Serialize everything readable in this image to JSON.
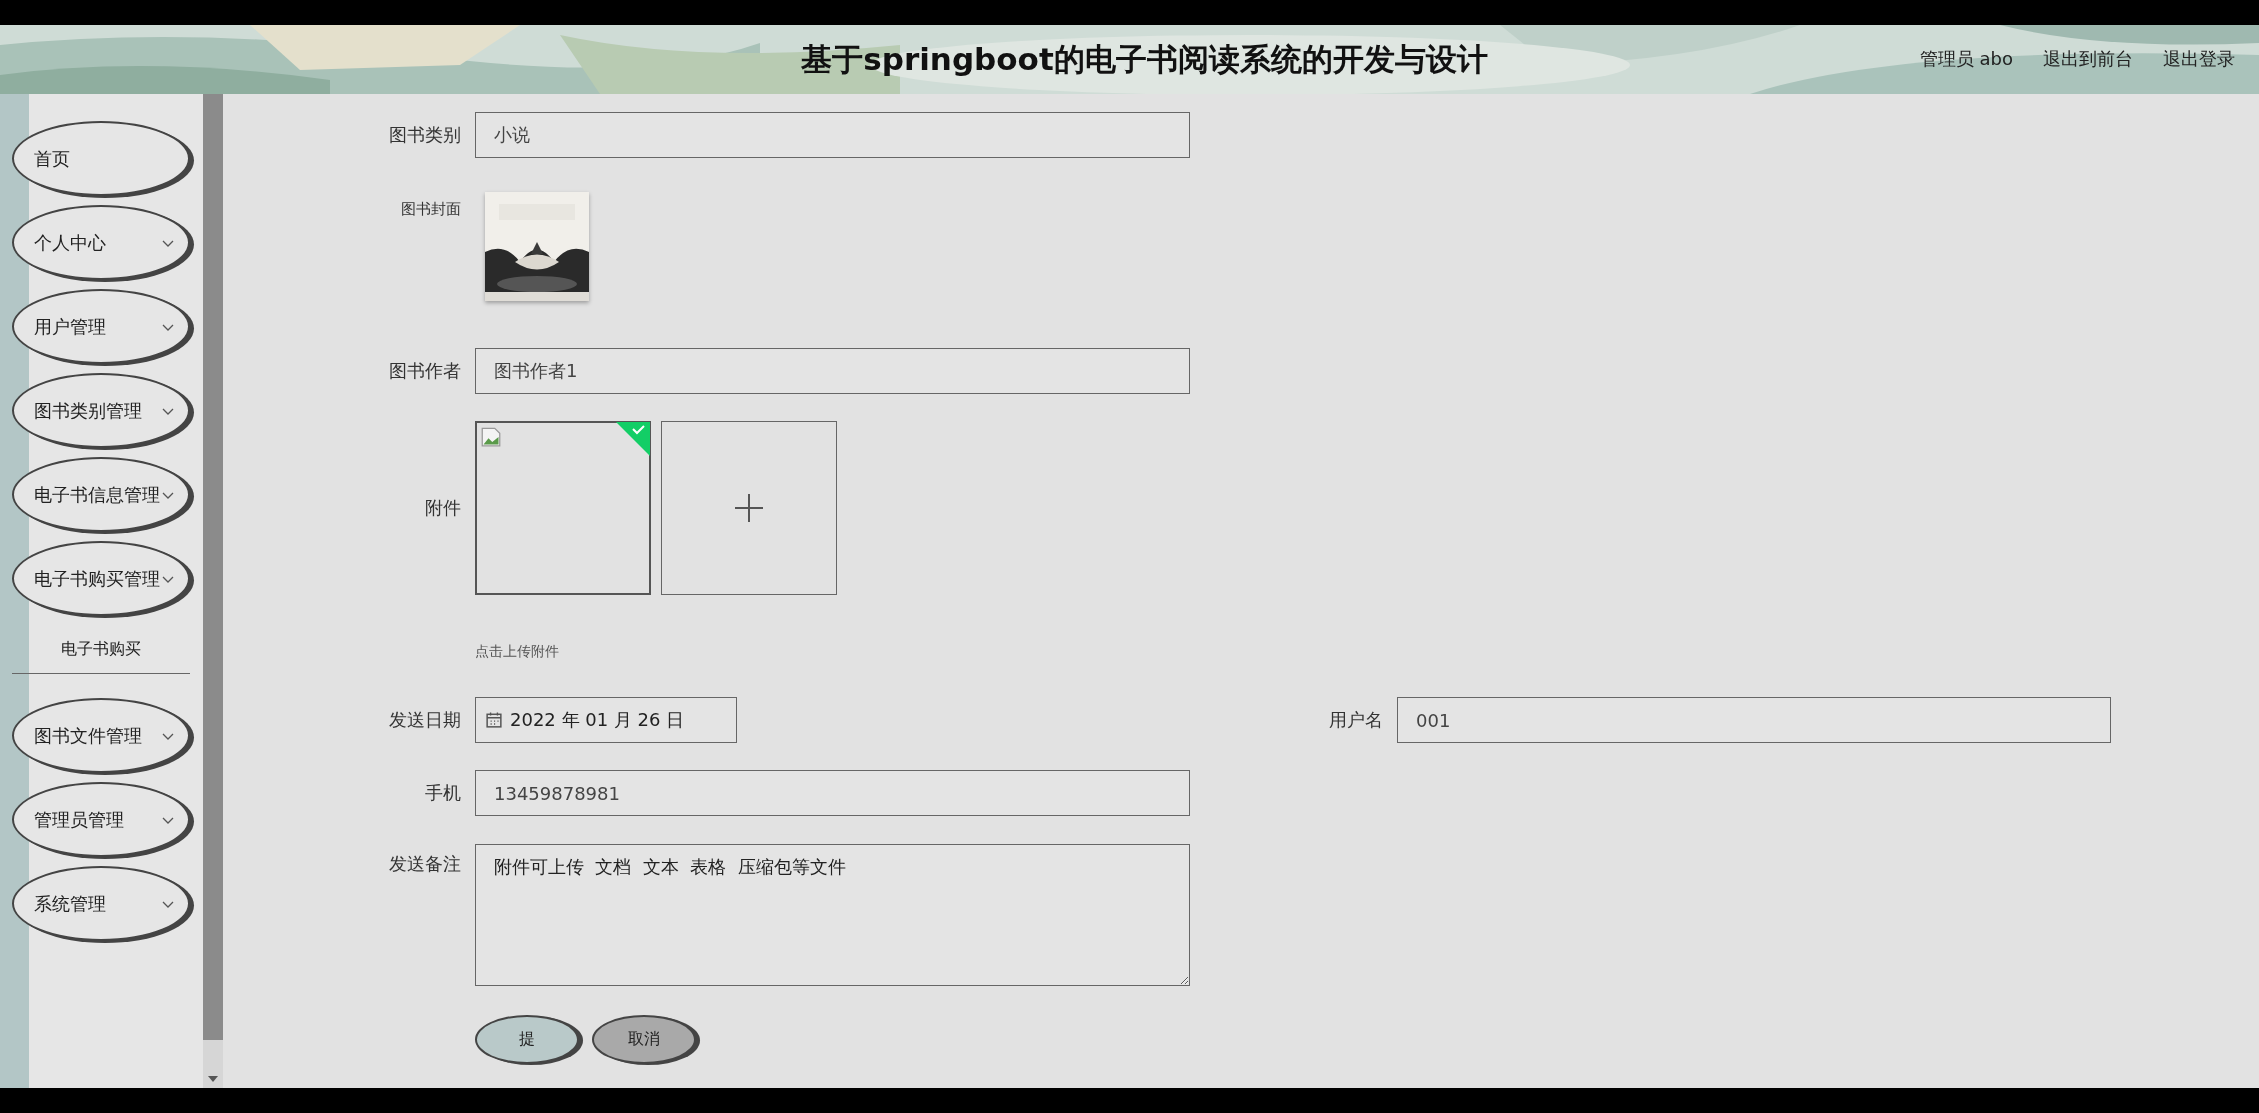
{
  "header": {
    "title": "基于springboot的电子书阅读系统的开发与设计",
    "links": [
      "管理员 abo",
      "退出到前台",
      "退出登录"
    ]
  },
  "sidebar": {
    "items": [
      {
        "label": "首页",
        "submenu": false
      },
      {
        "label": "个人中心",
        "submenu": true
      },
      {
        "label": "用户管理",
        "submenu": true
      },
      {
        "label": "图书类别管理",
        "submenu": true
      },
      {
        "label": "电子书信息管理",
        "submenu": true
      },
      {
        "label": "电子书购买管理",
        "submenu": true,
        "children": [
          {
            "label": "电子书购买"
          }
        ]
      },
      {
        "label": "图书文件管理",
        "submenu": true
      },
      {
        "label": "管理员管理",
        "submenu": true
      },
      {
        "label": "系统管理",
        "submenu": true
      }
    ]
  },
  "form": {
    "category": {
      "label": "图书类别",
      "value": "小说"
    },
    "cover": {
      "label": "图书封面",
      "kind": "picture"
    },
    "author": {
      "label": "图书作者",
      "value": "图书作者1"
    },
    "attachment": {
      "label": "附件",
      "files": [
        {
          "uploaded": true
        }
      ],
      "hint": "点击上传附件"
    },
    "send_date": {
      "label": "发送日期",
      "value": "2022 年 01 月 26 日"
    },
    "username": {
      "label": "用户名",
      "value": "001"
    },
    "phone": {
      "label": "手机",
      "value": "13459878981"
    },
    "remark": {
      "label": "发送备注",
      "value": "附件可上传  文档  文本  表格  压缩包等文件"
    },
    "buttons": [
      {
        "label": "提",
        "kind": "primary"
      },
      {
        "label": "取消",
        "kind": "secondary"
      }
    ]
  }
}
